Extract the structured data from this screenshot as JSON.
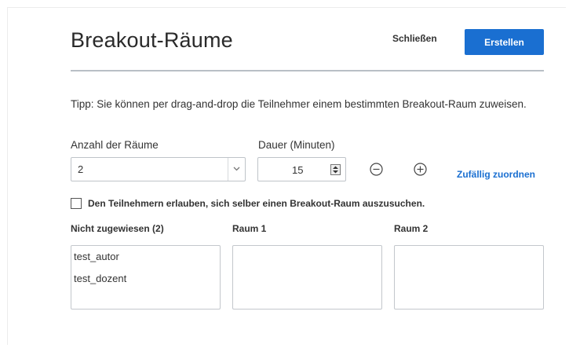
{
  "dialog": {
    "title": "Breakout-Räume",
    "close_label": "Schließen",
    "create_label": "Erstellen",
    "tip": "Tipp: Sie können per drag-and-drop die Teilnehmer einem bestimmten Breakout-Raum zuweisen."
  },
  "rooms_count": {
    "label": "Anzahl der Räume",
    "value": "2"
  },
  "duration": {
    "label": "Dauer (Minuten)",
    "value": "15"
  },
  "controls": {
    "random_assign_label": "Zufällig zuordnen",
    "minus_icon": "circle-minus-icon",
    "plus_icon": "circle-plus-icon"
  },
  "self_select": {
    "checked": false,
    "label": "Den Teilnehmern erlauben, sich selber einen Breakout-Raum auszusuchen."
  },
  "columns": [
    {
      "header": "Nicht zugewiesen (2)",
      "participants": [
        "test_autor",
        "test_dozent"
      ]
    },
    {
      "header": "Raum 1",
      "participants": []
    },
    {
      "header": "Raum 2",
      "participants": []
    }
  ],
  "colors": {
    "accent": "#1a6fd1",
    "divider": "#b9bfc6"
  }
}
